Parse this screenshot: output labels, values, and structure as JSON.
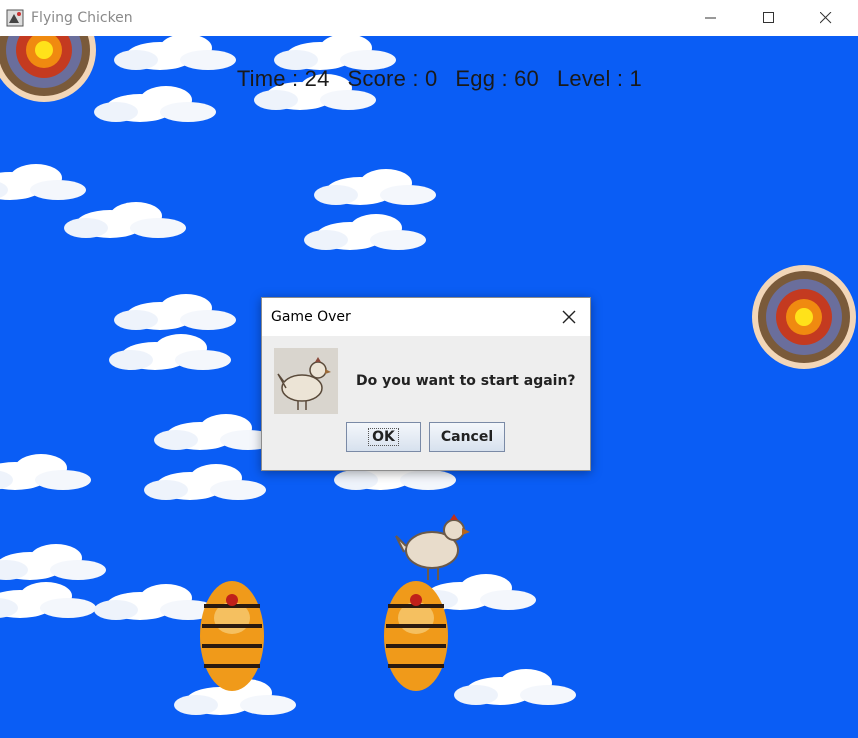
{
  "window": {
    "title": "Flying Chicken"
  },
  "hud": {
    "time": "Time : 24",
    "score": "Score : 0",
    "egg": "Egg : 60",
    "level": "Level : 1"
  },
  "dialog": {
    "title": "Game Over",
    "message": "Do you want to start again?",
    "ok_label": "OK",
    "cancel_label": "Cancel"
  },
  "colors": {
    "sky": "#0a5df5",
    "cloud": "#ffffff",
    "dialog_bg": "#eeeeee"
  },
  "icons": [
    "app-icon",
    "minimize-icon",
    "maximize-icon",
    "close-icon",
    "chicken-icon",
    "target-icon",
    "tiger-icon",
    "cloud-icon"
  ]
}
